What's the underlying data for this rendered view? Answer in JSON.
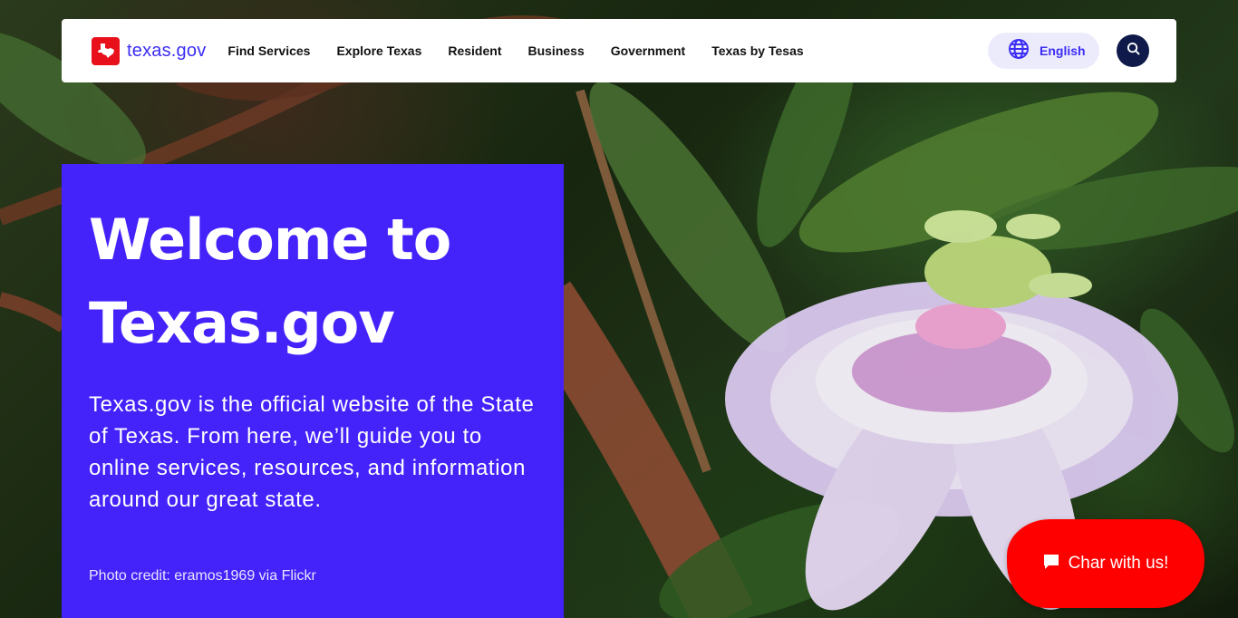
{
  "header": {
    "logo_text": "texas.gov",
    "nav": [
      {
        "label": "Find Services"
      },
      {
        "label": "Explore Texas"
      },
      {
        "label": "Resident"
      },
      {
        "label": "Business"
      },
      {
        "label": "Government"
      },
      {
        "label": "Texas by Tesas"
      }
    ],
    "language_label": "English",
    "icons": {
      "language": "globe-icon",
      "search": "search-icon",
      "logo": "texas-state-icon"
    }
  },
  "hero": {
    "title": "Welcome to Texas.gov",
    "description": "Texas.gov is the official website of the State of Texas. From here, we’ll guide you to online services, resources, and information around our great state.",
    "photo_credit": "Photo credit: eramos1969 via Flickr"
  },
  "chat": {
    "label": "Char with us!",
    "icon": "chat-bubble-icon"
  },
  "colors": {
    "brand_blue": "#4422fa",
    "logo_red": "#e8111b",
    "chat_red": "#ff0000",
    "search_navy": "#0f1a4a",
    "lang_bg": "#ecebfc"
  }
}
